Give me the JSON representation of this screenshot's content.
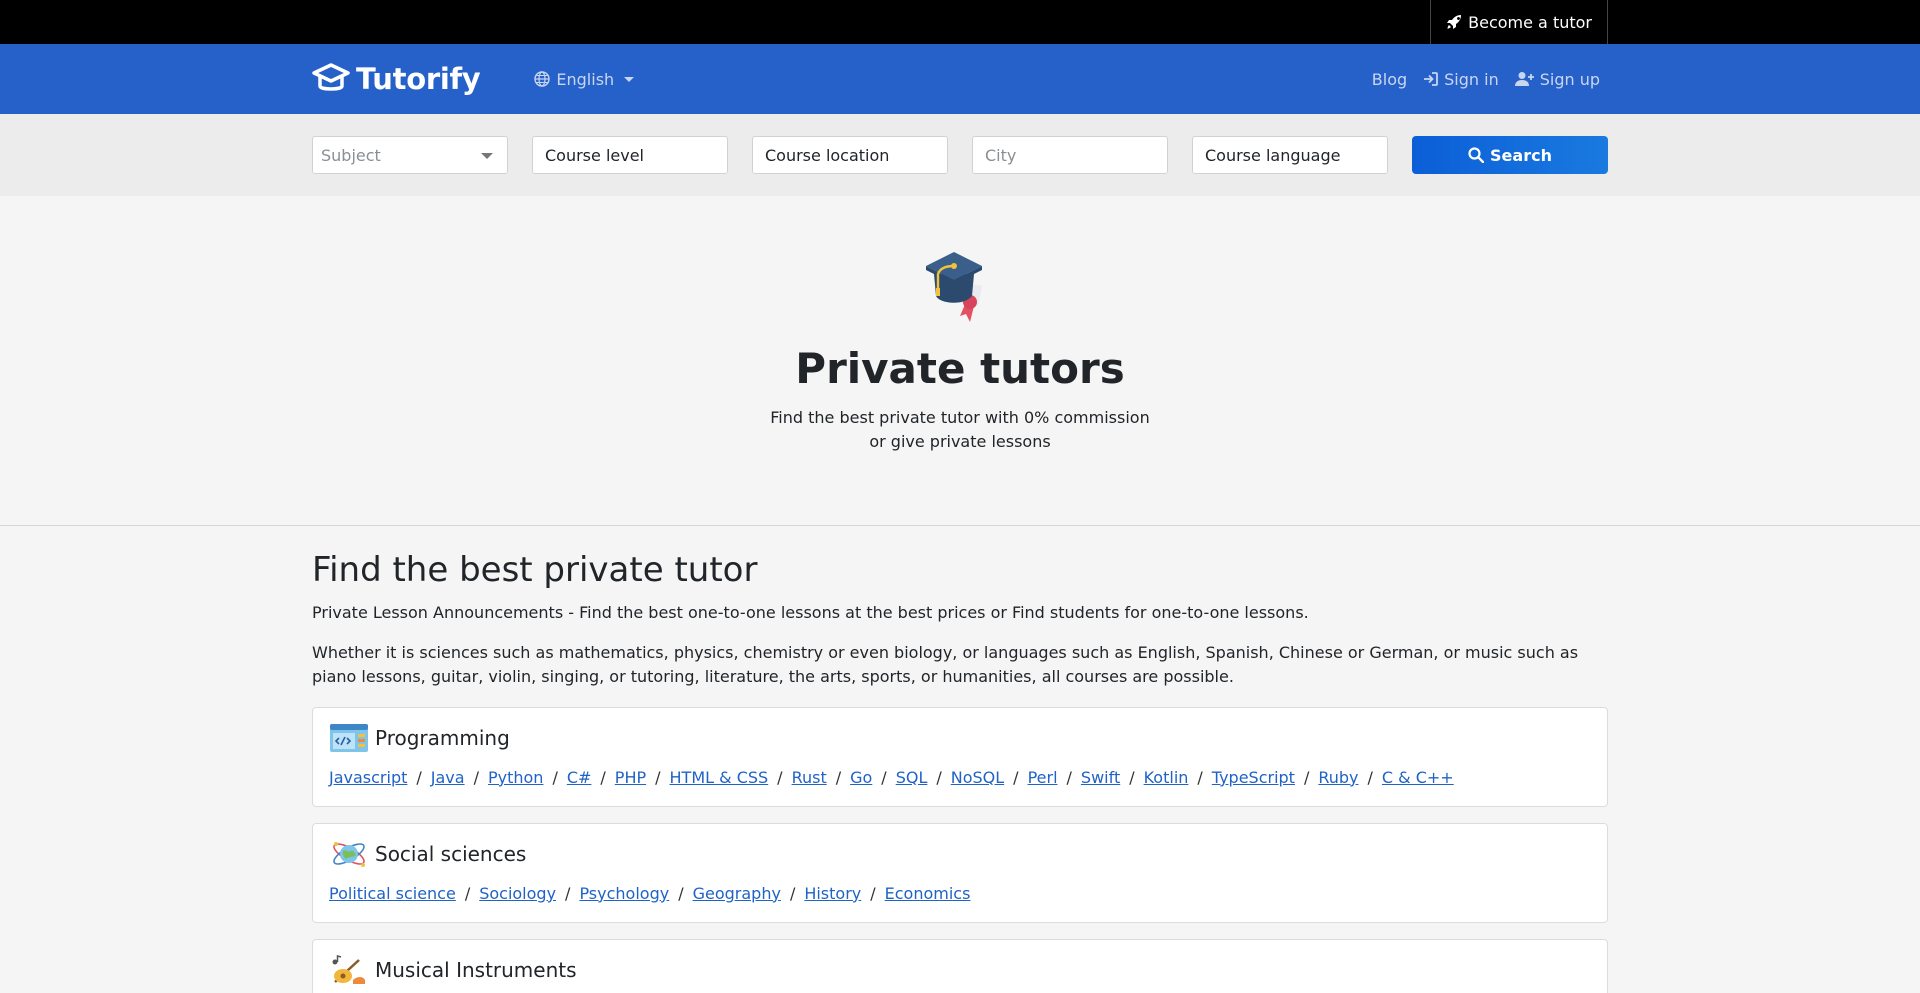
{
  "topbar": {
    "become_tutor": "Become a tutor"
  },
  "navbar": {
    "brand": "Tutorify",
    "language": "English",
    "blog": "Blog",
    "sign_in": "Sign in",
    "sign_up": "Sign up"
  },
  "search": {
    "subject_placeholder": "Subject",
    "course_level": "Course level",
    "course_location": "Course location",
    "city_placeholder": "City",
    "course_language": "Course language",
    "button": "Search"
  },
  "hero": {
    "title": "Private tutors",
    "line1": "Find the best private tutor with 0% commission",
    "line2": "or give private lessons"
  },
  "main": {
    "heading": "Find the best private tutor",
    "intro": "Private Lesson Announcements - Find the best one-to-one lessons at the best prices or Find students for one-to-one lessons.",
    "description": "Whether it is sciences such as mathematics, physics, chemistry or even biology, or languages such as English, Spanish, Chinese or German, or music such as piano lessons, guitar, violin, singing, or tutoring, literature, the arts, sports, or humanities, all courses are possible."
  },
  "categories": [
    {
      "title": "Programming",
      "icon": "code-window-icon",
      "links": [
        "Javascript",
        "Java",
        "Python",
        "C#",
        "PHP",
        "HTML & CSS",
        "Rust",
        "Go",
        "SQL",
        "NoSQL",
        "Perl",
        "Swift",
        "Kotlin",
        "TypeScript",
        "Ruby",
        "C & C++"
      ]
    },
    {
      "title": "Social sciences",
      "icon": "atom-globe-icon",
      "links": [
        "Political science",
        "Sociology",
        "Psychology",
        "Geography",
        "History",
        "Economics"
      ]
    },
    {
      "title": "Musical Instruments",
      "icon": "music-instruments-icon",
      "links": []
    }
  ],
  "colors": {
    "navbar": "#2660c9",
    "topbar": "#000000",
    "search_button": "#0b5ed7",
    "link": "#1f63c6"
  }
}
